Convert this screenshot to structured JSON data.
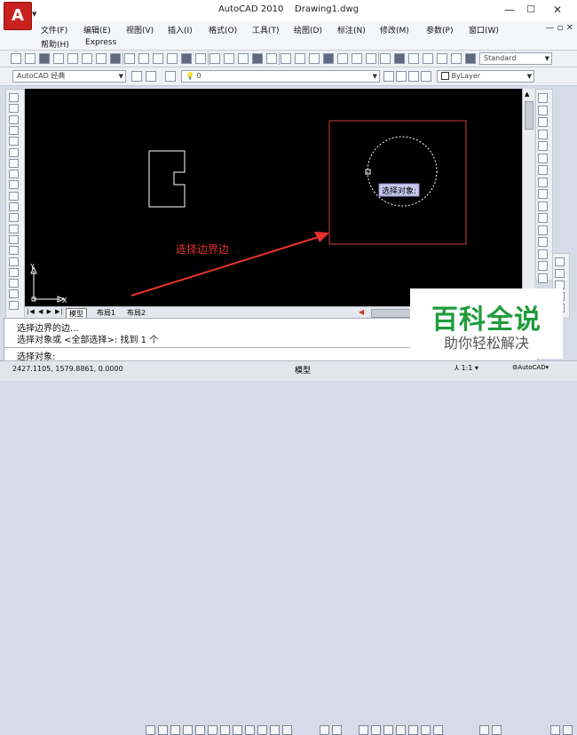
{
  "window": {
    "app_name": "AutoCAD 2010",
    "file_name": "Drawing1.dwg",
    "minimize": "—",
    "maximize": "☐",
    "close": "✕"
  },
  "menu_row1": [
    "文件(F)",
    "编辑(E)",
    "视图(V)",
    "插入(I)",
    "格式(O)",
    "工具(T)",
    "绘图(D)",
    "标注(N)",
    "修改(M)",
    "参数(P)",
    "窗口(W)"
  ],
  "menu_row2": [
    "帮助(H)",
    "Express"
  ],
  "toolbar": {
    "text_style": "Standard",
    "workspace": "AutoCAD 经典",
    "layer": "0",
    "color": "ByLayer"
  },
  "drawing": {
    "annotation": "选择边界边",
    "tooltip": "选择对象:",
    "ucs_x": "X",
    "ucs_y": "Y"
  },
  "layout_tabs": [
    "模型",
    "布局1",
    "布局2"
  ],
  "command": {
    "history": [
      "选择边界的边...",
      "选择对象或 <全部选择>:  找到 1 个"
    ],
    "prompt": "选择对象:"
  },
  "status": {
    "coords": "2427.1105, 1579.8861, 0.0000",
    "model": "模型",
    "scale": "1:1",
    "workspace": "AutoCAD"
  },
  "watermark": {
    "title": "百科全说",
    "subtitle": "助你轻松解决"
  },
  "colors": {
    "canvas": "#000000",
    "entity": "#ffffff",
    "selection": "#d23c3c",
    "annotation": "#e8322d",
    "watermark_green": "#1e9b3b"
  }
}
